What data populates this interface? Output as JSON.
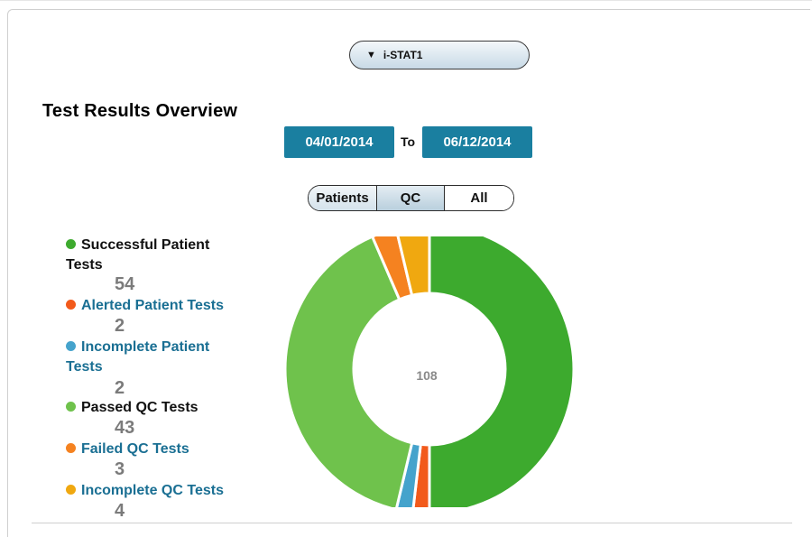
{
  "device_select": {
    "label": "i-STAT1",
    "icon": "triangle-down-icon"
  },
  "title": "Test Results Overview",
  "date_range": {
    "from": "04/01/2014",
    "to_label": "To",
    "to": "06/12/2014"
  },
  "filters": {
    "patients": "Patients",
    "qc": "QC",
    "all": "All"
  },
  "legend": [
    {
      "line1": "Successful Patient",
      "line2": "Tests",
      "value": "54",
      "color": "#3daa2e",
      "text_color": "#111111"
    },
    {
      "line1": "Alerted Patient Tests",
      "line2": "",
      "value": "2",
      "color": "#f25a1b",
      "text_color": "#1a6f93"
    },
    {
      "line1": "Incomplete Patient",
      "line2": "Tests",
      "value": "2",
      "color": "#45a3cc",
      "text_color": "#1a6f93"
    },
    {
      "line1": "Passed QC Tests",
      "line2": "",
      "value": "43",
      "color": "#6fc24c",
      "text_color": "#111111"
    },
    {
      "line1": "Failed QC Tests",
      "line2": "",
      "value": "3",
      "color": "#f58220",
      "text_color": "#1a6f93"
    },
    {
      "line1": "Incomplete QC Tests",
      "line2": "",
      "value": "4",
      "color": "#f0a810",
      "text_color": "#1a6f93"
    }
  ],
  "chart_data": {
    "type": "pie",
    "variant": "donut",
    "center_label": "108",
    "categories": [
      "Successful Patient Tests",
      "Alerted Patient Tests",
      "Incomplete Patient Tests",
      "Passed QC Tests",
      "Failed QC Tests",
      "Incomplete QC Tests"
    ],
    "values": [
      54,
      2,
      2,
      43,
      3,
      4
    ],
    "colors": [
      "#3daa2e",
      "#f25a1b",
      "#45a3cc",
      "#6fc24c",
      "#f58220",
      "#f0a810"
    ]
  }
}
